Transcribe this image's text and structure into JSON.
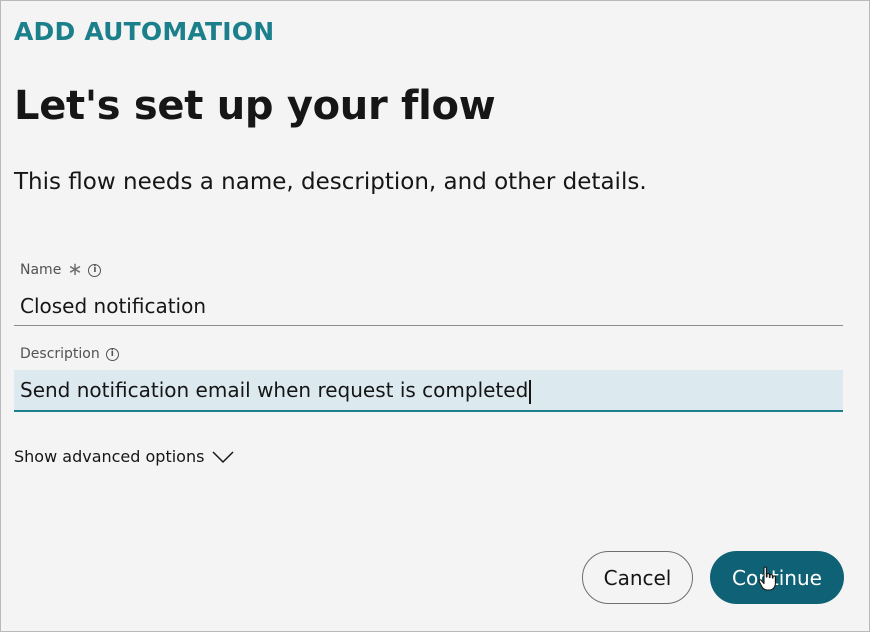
{
  "header": {
    "eyebrow": "ADD AUTOMATION",
    "title": "Let's set up your flow",
    "subtitle": "This flow needs a name, description, and other details."
  },
  "form": {
    "name": {
      "label": "Name",
      "required_icon": "asterisk-icon",
      "info_icon": "info-icon",
      "value": "Closed notification"
    },
    "description": {
      "label": "Description",
      "info_icon": "info-icon",
      "value": "Send notification email when request is completed"
    },
    "advanced_label": "Show advanced options"
  },
  "actions": {
    "cancel_label": "Cancel",
    "continue_label": "Continue"
  },
  "colors": {
    "accent": "#1b7f8c",
    "primary_button": "#0f6275",
    "active_field_bg": "#dceaf0"
  }
}
